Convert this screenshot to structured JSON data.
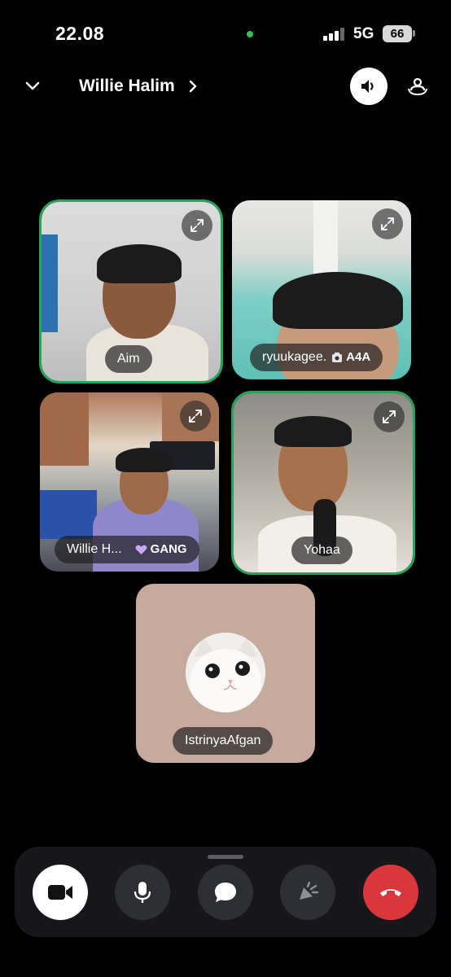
{
  "status_bar": {
    "time": "22.08",
    "network": "5G",
    "battery": "66"
  },
  "header": {
    "title": "Willie Halim"
  },
  "participants": [
    {
      "name": "Aim",
      "speaking": true,
      "tag": ""
    },
    {
      "name": "ryuukagee.",
      "speaking": false,
      "tag": "A4A",
      "tag_icon": "camera-badge-icon"
    },
    {
      "name": "Willie H...",
      "speaking": false,
      "tag": "GANG",
      "tag_icon": "heart-badge-icon"
    },
    {
      "name": "Yohaa",
      "speaking": true,
      "tag": ""
    },
    {
      "name": "IstrinyaAfgan",
      "speaking": false,
      "tag": "",
      "video": false
    }
  ],
  "controls": [
    {
      "name": "camera-toggle",
      "icon": "video-camera-icon",
      "active": true
    },
    {
      "name": "microphone-toggle",
      "icon": "microphone-icon"
    },
    {
      "name": "chat",
      "icon": "chat-bubble-icon"
    },
    {
      "name": "activities",
      "icon": "rocket-icon",
      "disabled": true
    },
    {
      "name": "disconnect",
      "icon": "hang-up-icon"
    }
  ],
  "colors": {
    "background": "#000000",
    "speaking_ring": "#23a55a",
    "hangup": "#da373c",
    "control_bg": "#2e2e35",
    "status_dot": "#2bc45e"
  }
}
